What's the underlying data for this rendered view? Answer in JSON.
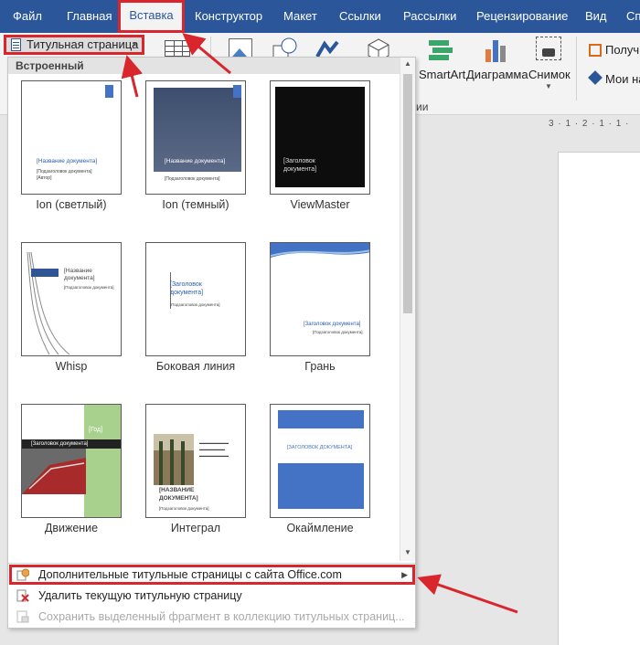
{
  "tabs": [
    {
      "label": "Файл",
      "active": false
    },
    {
      "label": "Главная",
      "active": false
    },
    {
      "label": "Вставка",
      "active": true
    },
    {
      "label": "Конструктор",
      "active": false
    },
    {
      "label": "Макет",
      "active": false
    },
    {
      "label": "Ссылки",
      "active": false
    },
    {
      "label": "Рассылки",
      "active": false
    },
    {
      "label": "Рецензирование",
      "active": false
    },
    {
      "label": "Вид",
      "active": false
    },
    {
      "label": "Сп",
      "active": false
    }
  ],
  "ribbon": {
    "cover_page_button": "Титульная страница",
    "smartart": "SmartArt",
    "chart": "Диаграмма",
    "screenshot": "Снимок",
    "get_addins": "Получ",
    "my_addins": "Мои на",
    "group_fragment": "ии"
  },
  "ruler_text": "3 · 1 · 2 · 1 · 1 ·",
  "gallery": {
    "header": "Встроенный",
    "templates": [
      {
        "label": "Ion (светлый)",
        "title": "[Название документа]",
        "subtitle": "[Подзаголовок документа]",
        "author": "[Автор]"
      },
      {
        "label": "Ion (темный)",
        "title": "[Название документа]",
        "subtitle": "[Подзаголовок документа]"
      },
      {
        "label": "ViewMaster",
        "title_line1": "[Заголовок",
        "title_line2": "документа]"
      },
      {
        "label": "Whisp",
        "title_line1": "[Название",
        "title_line2": "документа]",
        "subtitle": "[Подзаголовок документа]"
      },
      {
        "label": "Боковая линия",
        "title_line1": "[Заголовок",
        "title_line2": "документа]",
        "subtitle": "[Подзаголовок документа]"
      },
      {
        "label": "Грань",
        "title": "[Заголовок документа]",
        "subtitle": "[Подзаголовок документа]"
      },
      {
        "label": "Движение",
        "year": "[Год]",
        "title": "[Заголовок документа]"
      },
      {
        "label": "Интеграл",
        "title_line1": "[НАЗВАНИЕ",
        "title_line2": "ДОКУМЕНТА]",
        "subtitle": "[Подзаголовок документа]"
      },
      {
        "label": "Окаймление",
        "title": "[ЗАГОЛОВОК ДОКУМЕНТА]"
      }
    ]
  },
  "menu": {
    "more_covers": "Дополнительные титульные страницы с сайта Office.com",
    "remove_cover": "Удалить текущую титульную страницу",
    "save_selection": "Сохранить выделенный фрагмент в коллекцию титульных страниц..."
  },
  "colors": {
    "ribbon_blue": "#2b579a",
    "highlight_red": "#d9262c",
    "template_blue": "#4472c4",
    "whisp_green": "#a9d18e"
  }
}
